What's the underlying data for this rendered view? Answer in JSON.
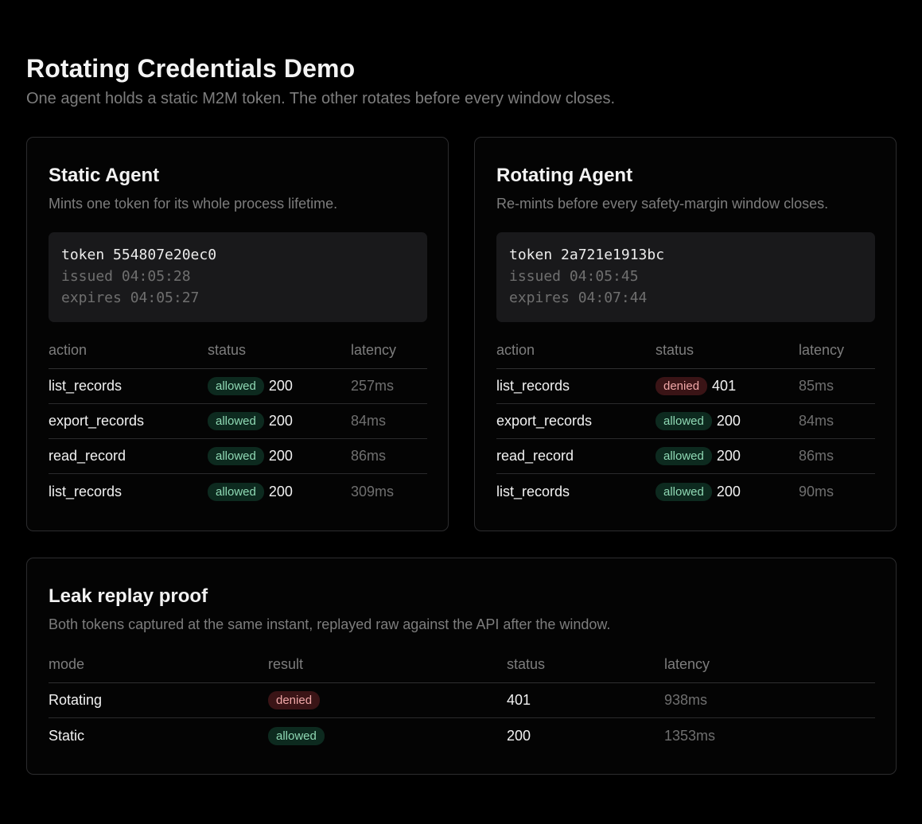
{
  "header": {
    "title": "Rotating Credentials Demo",
    "subtitle": "One agent holds a static M2M token. The other rotates before every window closes."
  },
  "columns": {
    "action": "action",
    "status": "status",
    "latency": "latency"
  },
  "static_agent": {
    "title": "Static Agent",
    "description": "Mints one token for its whole process lifetime.",
    "token": {
      "id": "token 554807e20ec0",
      "issued": "issued 04:05:28",
      "expires": "expires 04:05:27"
    },
    "rows": [
      {
        "action": "list_records",
        "badge": "allowed",
        "code": "200",
        "latency": "257ms"
      },
      {
        "action": "export_records",
        "badge": "allowed",
        "code": "200",
        "latency": "84ms"
      },
      {
        "action": "read_record",
        "badge": "allowed",
        "code": "200",
        "latency": "86ms"
      },
      {
        "action": "list_records",
        "badge": "allowed",
        "code": "200",
        "latency": "309ms"
      }
    ]
  },
  "rotating_agent": {
    "title": "Rotating Agent",
    "description": "Re-mints before every safety-margin window closes.",
    "token": {
      "id": "token 2a721e1913bc",
      "issued": "issued 04:05:45",
      "expires": "expires 04:07:44"
    },
    "rows": [
      {
        "action": "list_records",
        "badge": "denied",
        "code": "401",
        "latency": "85ms"
      },
      {
        "action": "export_records",
        "badge": "allowed",
        "code": "200",
        "latency": "84ms"
      },
      {
        "action": "read_record",
        "badge": "allowed",
        "code": "200",
        "latency": "86ms"
      },
      {
        "action": "list_records",
        "badge": "allowed",
        "code": "200",
        "latency": "90ms"
      }
    ]
  },
  "leak_proof": {
    "title": "Leak replay proof",
    "description": "Both tokens captured at the same instant, replayed raw against the API after the window.",
    "columns": {
      "mode": "mode",
      "result": "result",
      "status": "status",
      "latency": "latency"
    },
    "rows": [
      {
        "mode": "Rotating",
        "result": "denied",
        "status": "401",
        "latency": "938ms"
      },
      {
        "mode": "Static",
        "result": "allowed",
        "status": "200",
        "latency": "1353ms"
      }
    ]
  },
  "colors": {
    "background": "#000000",
    "card_border": "#2c2c2e",
    "allowed_bg": "#0d2a1f",
    "allowed_fg": "#8fd9b4",
    "denied_bg": "#3a1416",
    "denied_fg": "#f0a7a7",
    "muted_text": "#7d7d7d"
  }
}
